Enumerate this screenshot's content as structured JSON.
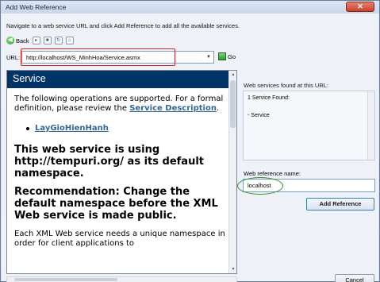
{
  "window": {
    "title": "Add Web Reference",
    "close_glyph": "✕"
  },
  "instruction": "Navigate to a web service URL and click Add Reference to add all the available services.",
  "toolbar": {
    "back_label": "Back"
  },
  "url": {
    "label": "URL:",
    "value": "http://localhost/WS_MinhHoa/Service.asmx",
    "go_label": "Go"
  },
  "browser": {
    "header": "Service",
    "intro_prefix": "The following operations are supported. For a formal definition, please review the ",
    "intro_link": "Service Description",
    "intro_suffix": ".",
    "operation": "LayGioHienHanh",
    "heading1": "This web service is using http://tempuri.org/ as its default namespace.",
    "heading2": "Recommendation: Change the default namespace before the XML Web service is made public.",
    "para": "Each XML Web service needs a unique namespace in order for client applications to"
  },
  "found_panel": {
    "label": "Web services found at this URL:",
    "count_text": "1 Service Found:",
    "item": "- Service"
  },
  "reference": {
    "label": "Web reference name:",
    "value": "localhost"
  },
  "buttons": {
    "add_reference": "Add Reference",
    "cancel": "Cancel"
  },
  "colors": {
    "service_header_bg": "#003366",
    "link": "#336699",
    "url_highlight": "#c82a2a",
    "ref_highlight": "#2f8a2f"
  }
}
